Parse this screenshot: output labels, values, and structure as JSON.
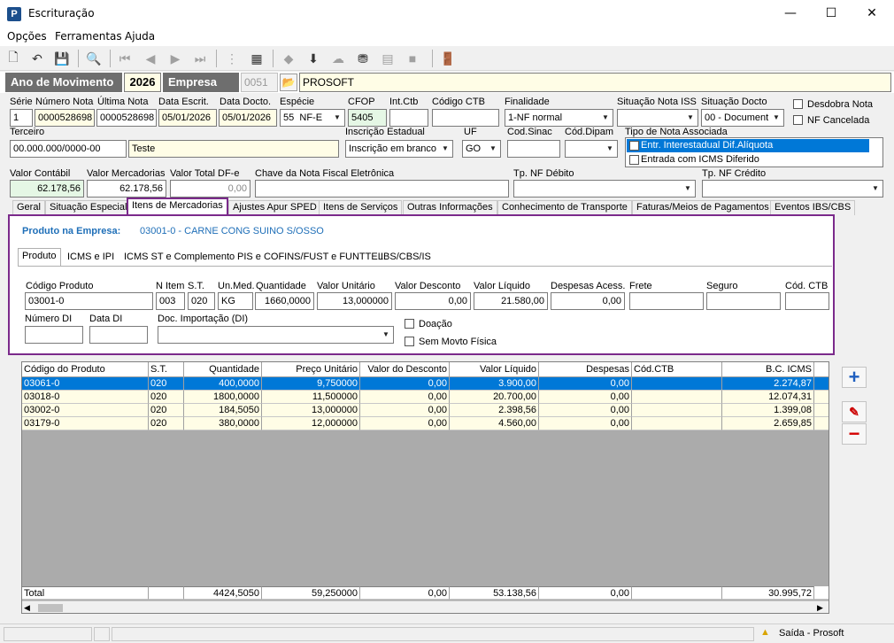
{
  "window": {
    "title": "Escrituração",
    "minimize": "—",
    "maximize": "☐",
    "close": "✕",
    "logo": "P"
  },
  "menu": [
    "Opções",
    "Ferramentas",
    "Ajuda"
  ],
  "header": {
    "ano_label": "Ano de Movimento",
    "ano_value": "2026",
    "empresa_label": "Empresa",
    "empresa_code": "0051",
    "empresa_name": "PROSOFT"
  },
  "nota": {
    "serie_label": "Série",
    "serie": "1",
    "numero_label": "Número Nota",
    "numero": "0000528698",
    "ultima_label": "Última Nota",
    "ultima": "0000528698",
    "data_escrit_label": "Data Escrit.",
    "data_escrit": "05/01/2026",
    "data_docto_label": "Data Docto.",
    "data_docto": "05/01/2026",
    "especie_label": "Espécie",
    "especie_code": "55",
    "especie": "NF-E",
    "cfop_label": "CFOP",
    "cfop": "5405",
    "intctb_label": "Int.Ctb",
    "intctb": "",
    "codctb_label": "Código CTB",
    "codctb": "",
    "finalidade_label": "Finalidade",
    "finalidade": "1-NF normal",
    "sit_iss_label": "Situação Nota ISS",
    "sit_iss": "",
    "sit_docto_label": "Situação Docto",
    "sit_docto": "00 - Document",
    "desdobra_label": "Desdobra Nota",
    "cancelada_label": "NF Cancelada",
    "terceiro_label": "Terceiro",
    "terceiro_doc": "00.000.000/0000-00",
    "terceiro_nome": "Teste",
    "ie_label": "Inscrição Estadual",
    "ie": "Inscrição em branco",
    "uf_label": "UF",
    "uf": "GO",
    "sinac_label": "Cod.Sinac",
    "sinac": "",
    "dipam_label": "Cód.Dipam",
    "dipam": "",
    "tipo_assoc_label": "Tipo de Nota Associada",
    "tipo_assoc_items": [
      "Entr. Interestadual Dif.Alíquota",
      "Entrada com ICMS Diferido"
    ],
    "valor_contabil_label": "Valor Contábil",
    "valor_contabil": "62.178,56",
    "valor_merc_label": "Valor Mercadorias",
    "valor_merc": "62.178,56",
    "valor_dfe_label": "Valor Total DF-e",
    "valor_dfe": "0,00",
    "chave_label": "Chave da Nota Fiscal Eletrônica",
    "chave": "",
    "tp_debito_label": "Tp. NF Débito",
    "tp_debito": "",
    "tp_credito_label": "Tp. NF Crédito",
    "tp_credito": ""
  },
  "tabs": [
    "Geral",
    "Situação Especial",
    "Itens de Mercadorias",
    "Ajustes Apur SPED",
    "Itens de Serviços",
    "Outras Informações",
    "Conhecimento de Transporte",
    "Faturas/Meios de Pagamentos",
    "Eventos IBS/CBS"
  ],
  "produto_empresa": {
    "label": "Produto na Empresa:",
    "value": "03001-0 - CARNE CONG SUINO S/OSSO"
  },
  "subtabs": [
    "Produto",
    "ICMS e IPI",
    "ICMS ST e Complemento",
    "PIS e COFINS/FUST e FUNTTEL",
    "IBS/CBS/IS"
  ],
  "produto": {
    "cod_label": "Código Produto",
    "cod": "03001-0",
    "nitem_label": "N Item",
    "nitem": "003",
    "st_label": "S.T.",
    "st": "020",
    "unmed_label": "Un.Med.",
    "unmed": "KG",
    "qtd_label": "Quantidade",
    "qtd": "1660,0000",
    "vunit_label": "Valor Unitário",
    "vunit": "13,000000",
    "vdesc_label": "Valor Desconto",
    "vdesc": "0,00",
    "vliq_label": "Valor Líquido",
    "vliq": "21.580,00",
    "desp_label": "Despesas Acess.",
    "desp": "0,00",
    "frete_label": "Frete",
    "frete": "",
    "seguro_label": "Seguro",
    "seguro": "",
    "codctb_label": "Cód. CTB",
    "codctb": "",
    "numdi_label": "Número DI",
    "numdi": "",
    "datadi_label": "Data DI",
    "datadi": "",
    "docimp_label": "Doc. Importação (DI)",
    "docimp": "",
    "doacao_label": "Doação",
    "semmovto_label": "Sem Movto Física"
  },
  "grid": {
    "columns": [
      "Código do Produto",
      "S.T.",
      "Quantidade",
      "Preço Unitário",
      "Valor do Desconto",
      "Valor Líquido",
      "Despesas",
      "Cód.CTB",
      "B.C. ICMS"
    ],
    "rows": [
      [
        "03061-0",
        "020",
        "400,0000",
        "9,750000",
        "0,00",
        "3.900,00",
        "0,00",
        "",
        "2.274,87"
      ],
      [
        "03018-0",
        "020",
        "1800,0000",
        "11,500000",
        "0,00",
        "20.700,00",
        "0,00",
        "",
        "12.074,31"
      ],
      [
        "03002-0",
        "020",
        "184,5050",
        "13,000000",
        "0,00",
        "2.398,56",
        "0,00",
        "",
        "1.399,08"
      ],
      [
        "03179-0",
        "020",
        "380,0000",
        "12,000000",
        "0,00",
        "4.560,00",
        "0,00",
        "",
        "2.659,85"
      ]
    ],
    "total": [
      "Total",
      "",
      "4424,5050",
      "59,250000",
      "0,00",
      "53.138,56",
      "0,00",
      "",
      "30.995,72"
    ]
  },
  "status": {
    "text": "Saída - Prosoft"
  },
  "colors": {
    "selected": "#0078d7",
    "tab_border": "#7b2a8b",
    "yellow_row": "#fffde6",
    "link_blue": "#1f6fb8"
  }
}
